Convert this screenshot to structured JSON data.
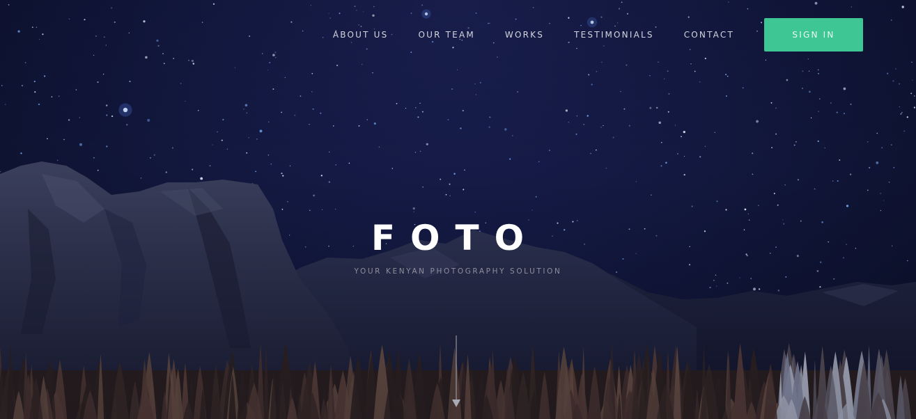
{
  "nav": {
    "items": [
      {
        "label": "ABOUT US"
      },
      {
        "label": "OUR TEAM"
      },
      {
        "label": "WORKS"
      },
      {
        "label": "TESTIMONIALS"
      },
      {
        "label": "CONTACT"
      }
    ],
    "signin_label": "SIGN IN"
  },
  "hero": {
    "title": "FOTO",
    "subtitle": "YOUR KENYAN PHOTOGRAPHY SOLUTION"
  },
  "colors": {
    "accent": "#3ec795",
    "sky": "#141a44",
    "text": "#ffffff",
    "muted": "#8d8f9c"
  },
  "icons": {
    "scroll": "arrow-down-icon"
  }
}
